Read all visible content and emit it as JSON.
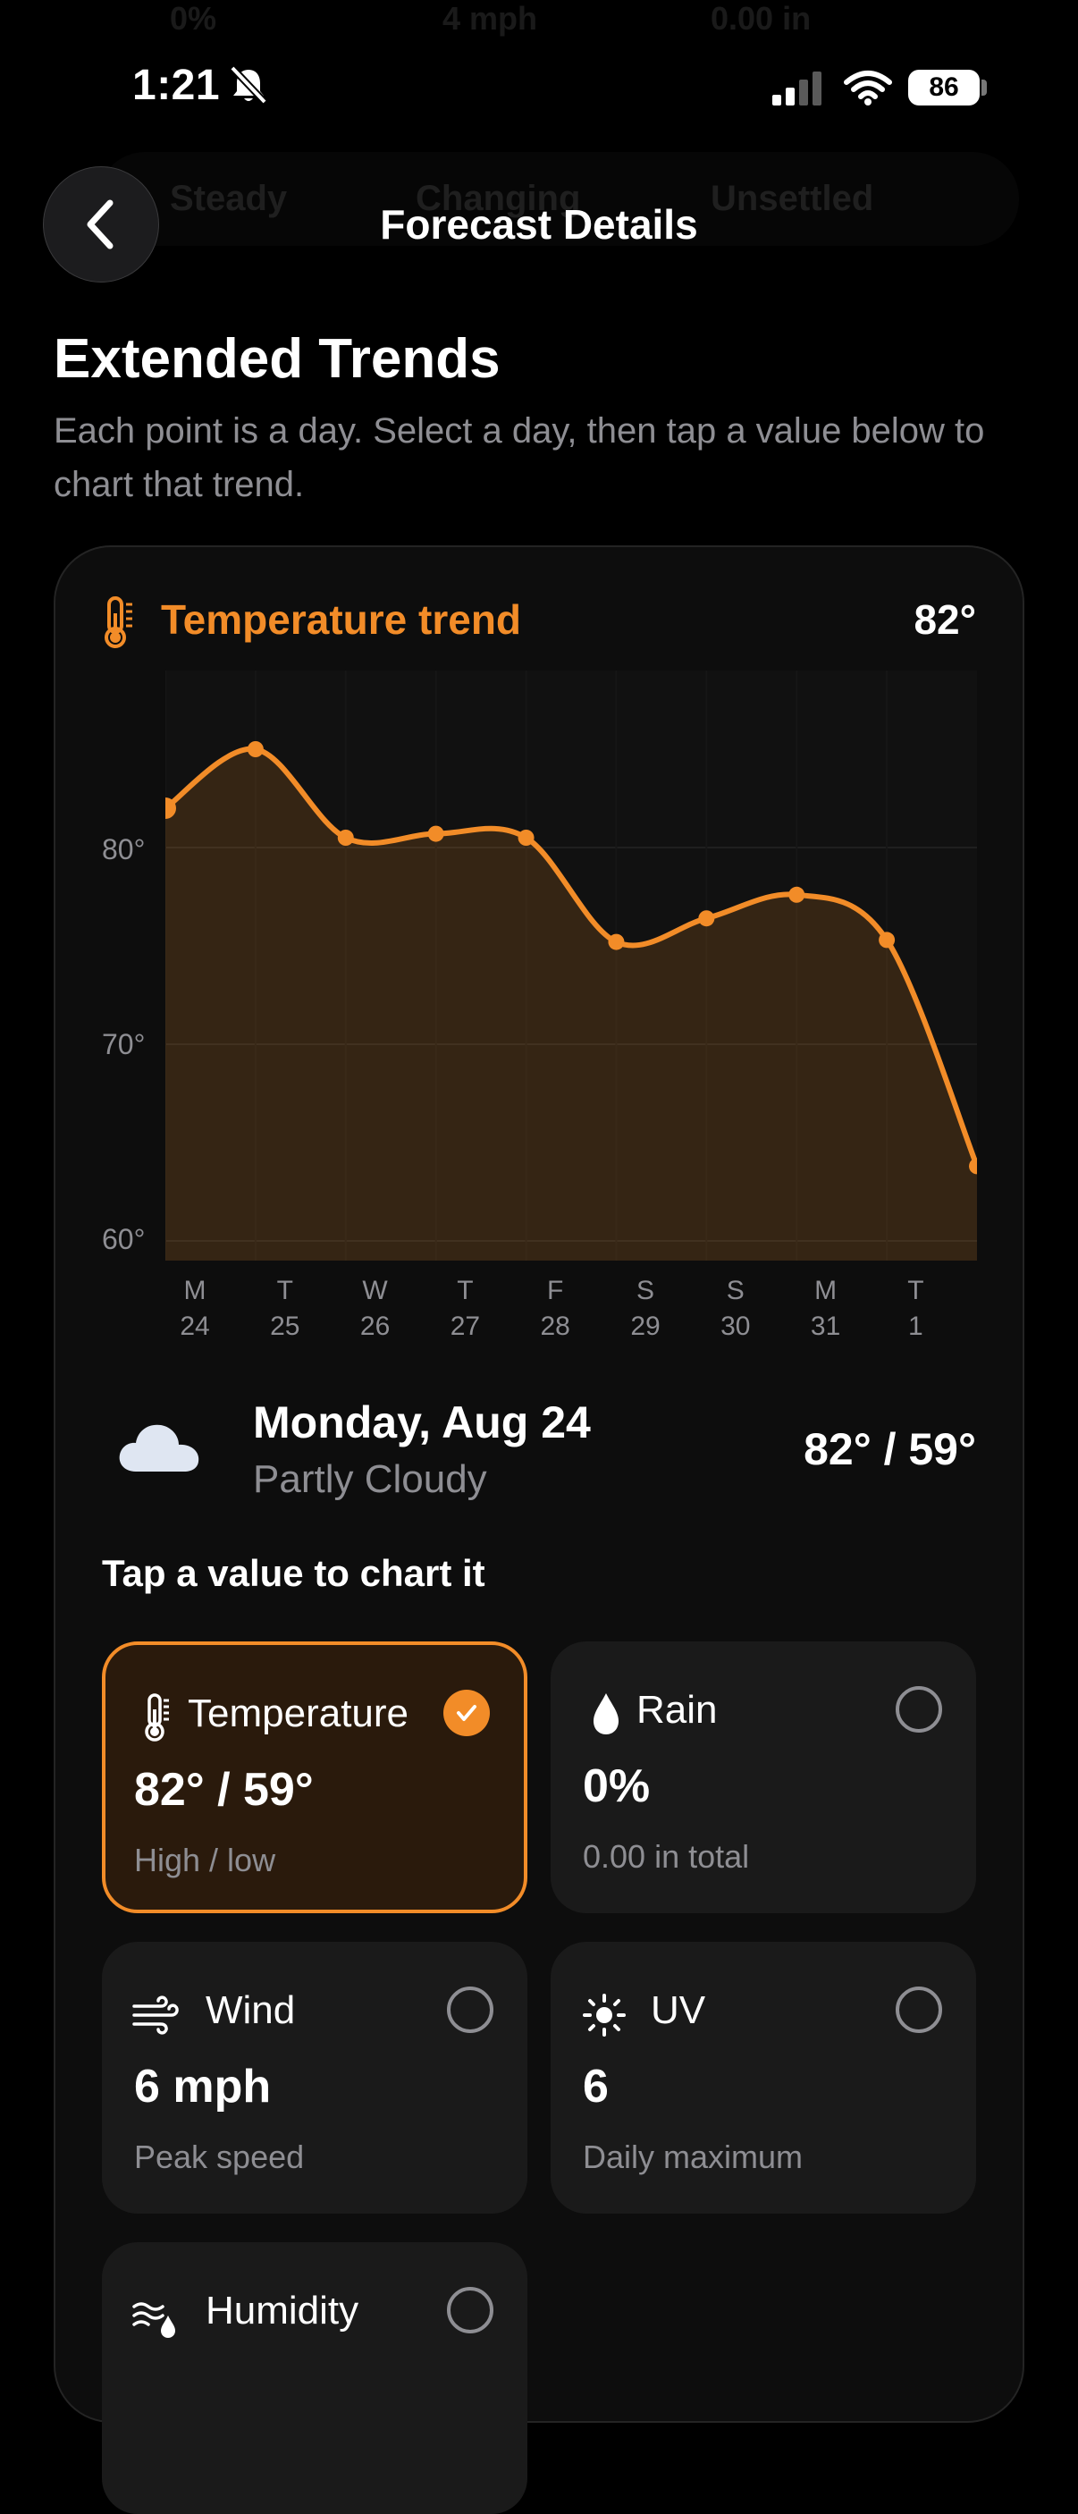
{
  "ghost": {
    "row": [
      "0%",
      "4 mph",
      "0.00 in"
    ],
    "pills": [
      "Steady",
      "Changing",
      "Unsettled"
    ]
  },
  "status_bar": {
    "time": "1:21",
    "battery": "86"
  },
  "nav": {
    "title": "Forecast Details"
  },
  "section": {
    "title": "Extended Trends",
    "subtitle": "Each point is a day. Select a day, then tap a value below to chart that trend."
  },
  "trend": {
    "label": "Temperature trend",
    "value": "82°",
    "accent": "#f28c28"
  },
  "chart_data": {
    "type": "area",
    "y_tick_labels": [
      "80°",
      "70°",
      "60°"
    ],
    "y_ticks": [
      80,
      70,
      60
    ],
    "ylim": [
      59,
      89
    ],
    "x_tick_labels": [
      [
        "M",
        "24"
      ],
      [
        "T",
        "25"
      ],
      [
        "W",
        "26"
      ],
      [
        "T",
        "27"
      ],
      [
        "F",
        "28"
      ],
      [
        "S",
        "29"
      ],
      [
        "S",
        "30"
      ],
      [
        "M",
        "31"
      ],
      [
        "T",
        "1"
      ]
    ],
    "series": [
      {
        "values": [
          82,
          85,
          80.5,
          80.7,
          80.5,
          75.2,
          76.4,
          77.6,
          75.3,
          63.8
        ]
      }
    ],
    "grid": true,
    "color": "#f28c28"
  },
  "selected_day": {
    "title": "Monday, Aug 24",
    "condition": "Partly Cloudy",
    "temps": "82° / 59°"
  },
  "tap_hint": "Tap a value to chart it",
  "tiles": [
    {
      "name": "Temperature",
      "value": "82° / 59°",
      "caption": "High / low",
      "selected": true,
      "icon": "thermometer-icon"
    },
    {
      "name": "Rain",
      "value": "0%",
      "caption": "0.00 in total",
      "selected": false,
      "icon": "raindrop-icon"
    },
    {
      "name": "Wind",
      "value": "6 mph",
      "caption": "Peak speed",
      "selected": false,
      "icon": "wind-icon"
    },
    {
      "name": "UV",
      "value": "6",
      "caption": "Daily maximum",
      "selected": false,
      "icon": "sun-icon"
    },
    {
      "name": "Humidity",
      "value": "",
      "caption": "",
      "selected": false,
      "icon": "humidity-icon"
    }
  ]
}
